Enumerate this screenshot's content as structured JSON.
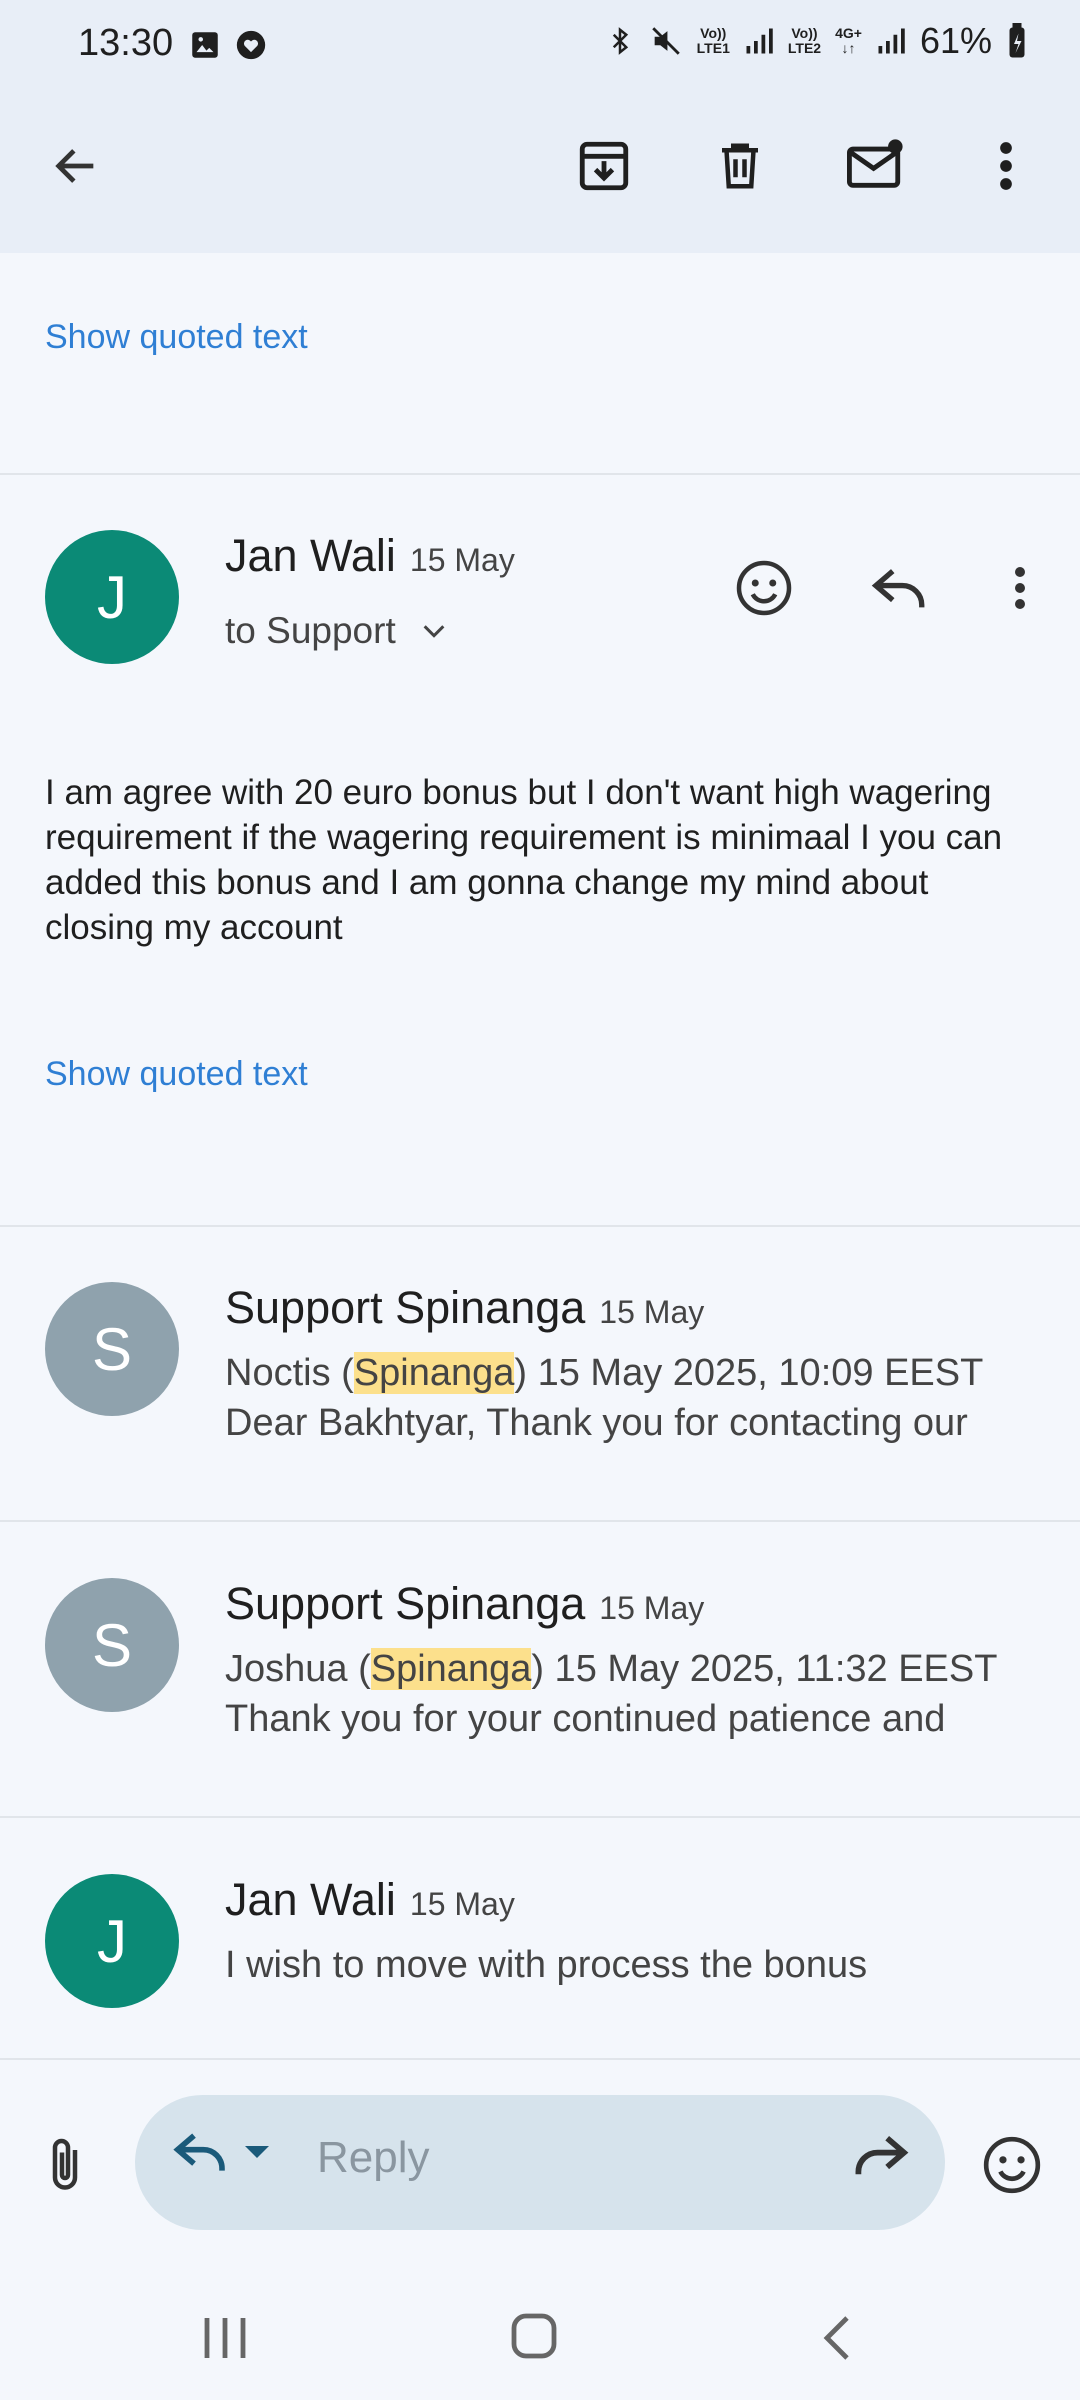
{
  "status": {
    "time": "13:30",
    "net1": [
      "Vo))",
      "LTE1"
    ],
    "net2": [
      "Vo))",
      "LTE2"
    ],
    "net3": "4G+",
    "battery": "61%"
  },
  "toolbar": {
    "back": "back-arrow",
    "archive": "archive-icon",
    "delete": "trash-icon",
    "mark_unread": "mail-unread-icon",
    "more": "more-vert-icon"
  },
  "thread": {
    "quoted_top": "Show quoted text",
    "expanded": {
      "avatar_letter": "J",
      "sender": "Jan Wali",
      "date": "15 May",
      "to": "to Support",
      "body": "I am agree with 20 euro bonus but I don't want high wagering requirement if the wagering requirement is minimaal I you can added this bonus and I am gonna change my mind about closing my account",
      "quoted": "Show quoted text"
    },
    "collapsed": [
      {
        "avatar_letter": "S",
        "sender": "Support Spinanga",
        "date": "15 May",
        "line1_pre": "Noctis (",
        "line1_hl": "Spinanga",
        "line1_post": ") 15 May 2025, 10:09 EEST",
        "line2": "Dear Bakhtyar, Thank you for contacting our"
      },
      {
        "avatar_letter": "S",
        "sender": "Support Spinanga",
        "date": "15 May",
        "line1_pre": "Joshua (",
        "line1_hl": "Spinanga",
        "line1_post": ") 15 May 2025, 11:32 EEST",
        "line2": "Thank you for your continued patience and"
      },
      {
        "avatar_letter": "J",
        "sender": "Jan Wali",
        "date": "15 May",
        "line1": "I wish to move with process the bonus"
      }
    ]
  },
  "reply": {
    "placeholder": "Reply"
  },
  "colors": {
    "accent_link": "#2f7fd4",
    "avatar_green": "#0b8a76",
    "avatar_gray": "#8fa2ad",
    "highlight": "#fce08c"
  }
}
